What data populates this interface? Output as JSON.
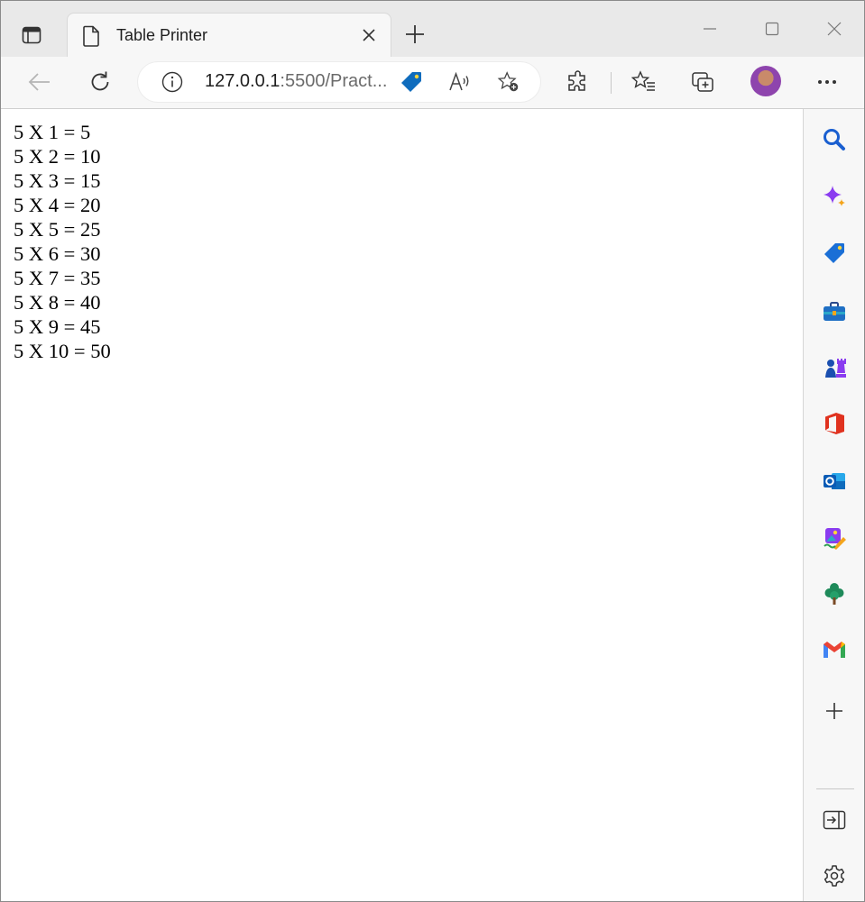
{
  "tab": {
    "title": "Table Printer"
  },
  "address": {
    "host": "127.0.0.1",
    "rest": ":5500/Pract..."
  },
  "content": {
    "lines": [
      "5 X 1 = 5",
      "5 X 2 = 10",
      "5 X 3 = 15",
      "5 X 4 = 20",
      "5 X 5 = 25",
      "5 X 6 = 30",
      "5 X 7 = 35",
      "5 X 8 = 40",
      "5 X 9 = 45",
      "5 X 10 = 50"
    ]
  },
  "icons": {
    "toolbar": [
      "back-icon",
      "refresh-icon",
      "site-info-icon",
      "coupon-tag-icon",
      "read-aloud-icon",
      "add-favorite-icon",
      "extensions-icon",
      "favorites-icon",
      "collections-icon",
      "profile-avatar",
      "more-icon"
    ],
    "sidebar": [
      "search-icon",
      "copilot-icon",
      "shopping-icon",
      "tools-icon",
      "games-icon",
      "office-icon",
      "outlook-icon",
      "designer-icon",
      "tree-icon",
      "gmail-icon",
      "add-icon",
      "hide-sidebar-icon",
      "settings-icon"
    ]
  },
  "colors": {
    "chrome_bg": "#e9e9e9",
    "toolbar_bg": "#f7f7f7",
    "accent_blue": "#0f6cbd",
    "text": "#000000"
  }
}
